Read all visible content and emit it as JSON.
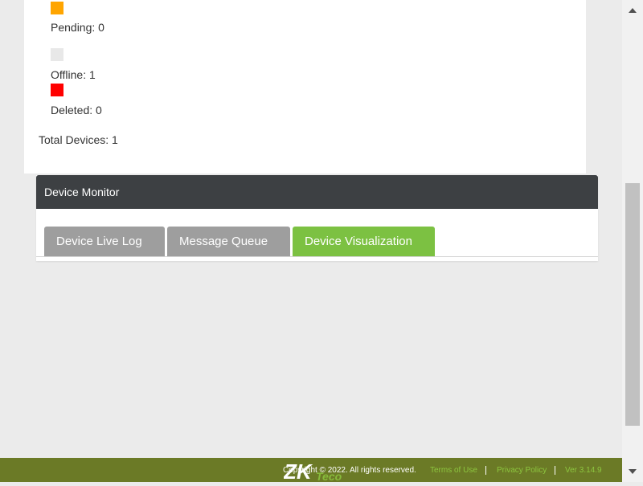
{
  "status_card": {
    "legend": [
      {
        "label": "Pending: 0",
        "color": "#ffa500"
      },
      {
        "label": "Offline: 1",
        "color": "#e8e8e8"
      },
      {
        "label": "Deleted: 0",
        "color": "#ff0000"
      }
    ],
    "total_label": "Total Devices: 1"
  },
  "monitor": {
    "title": "Device Monitor",
    "tabs": [
      {
        "label": "Device Live Log",
        "active": false
      },
      {
        "label": "Message Queue",
        "active": false
      },
      {
        "label": "Device Visualization",
        "active": true
      }
    ]
  },
  "footer": {
    "logo_text": "ZKTeco",
    "copyright": "Copyright © 2022. All rights reserved.",
    "links": [
      "Terms of Use",
      "Privacy Policy",
      "Ver 3.14.9"
    ]
  },
  "colors": {
    "tab_active": "#7cc142",
    "tab_inactive": "#9e9e9e",
    "header_bg": "#3d4043",
    "footer_bg": "#6b7a26",
    "footer_link": "#8dc63f"
  },
  "icons": {
    "scroll_up": "triangle-up-icon",
    "scroll_down": "triangle-down-icon"
  }
}
